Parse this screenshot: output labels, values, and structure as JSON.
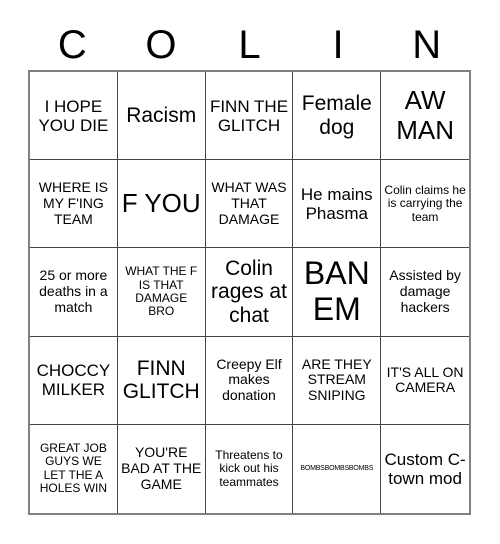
{
  "header": {
    "letters": [
      "C",
      "O",
      "L",
      "I",
      "N"
    ]
  },
  "grid": {
    "rows": 5,
    "columns": 5,
    "cells": [
      {
        "text": "I HOPE YOU DIE",
        "size": "fs-lg"
      },
      {
        "text": "Racism",
        "size": "fs-xl"
      },
      {
        "text": "FINN THE GLITCH",
        "size": "fs-lg"
      },
      {
        "text": "Female dog",
        "size": "fs-xl"
      },
      {
        "text": "AW MAN",
        "size": "fs-xxl"
      },
      {
        "text": "WHERE IS MY F'ING TEAM",
        "size": "fs-md"
      },
      {
        "text": "F YOU",
        "size": "fs-xxl"
      },
      {
        "text": "WHAT WAS THAT DAMAGE",
        "size": "fs-md"
      },
      {
        "text": "He mains Phasma",
        "size": "fs-lg"
      },
      {
        "text": "Colin claims he is carrying the team",
        "size": "fs-sm"
      },
      {
        "text": "25 or more deaths in a match",
        "size": "fs-md"
      },
      {
        "text": "WHAT THE F IS THAT DAMAGE BRO",
        "size": "fs-sm"
      },
      {
        "text": "Colin rages at chat",
        "size": "fs-xl"
      },
      {
        "text": "BAN EM",
        "size": "fs-huge"
      },
      {
        "text": "Assisted by damage hackers",
        "size": "fs-md"
      },
      {
        "text": "CHOCCY MILKER",
        "size": "fs-lg"
      },
      {
        "text": "FINN GLITCH",
        "size": "fs-xl"
      },
      {
        "text": "Creepy Elf makes donation",
        "size": "fs-md"
      },
      {
        "text": "ARE THEY STREAM SNIPING",
        "size": "fs-md"
      },
      {
        "text": "IT'S ALL ON CAMERA",
        "size": "fs-md"
      },
      {
        "text": "GREAT JOB GUYS WE LET THE A HOLES WIN",
        "size": "fs-sm"
      },
      {
        "text": "YOU'RE BAD AT THE GAME",
        "size": "fs-md"
      },
      {
        "text": "Threatens to kick out his teammates",
        "size": "fs-sm"
      },
      {
        "text": "BOMBSBOMBSBOMBS",
        "size": "fs-xs"
      },
      {
        "text": "Custom C-town mod",
        "size": "fs-lg"
      }
    ]
  },
  "colors": {
    "background": "#ffffff",
    "text": "#000000",
    "grid_line": "#444444",
    "outer_border": "#808080"
  }
}
